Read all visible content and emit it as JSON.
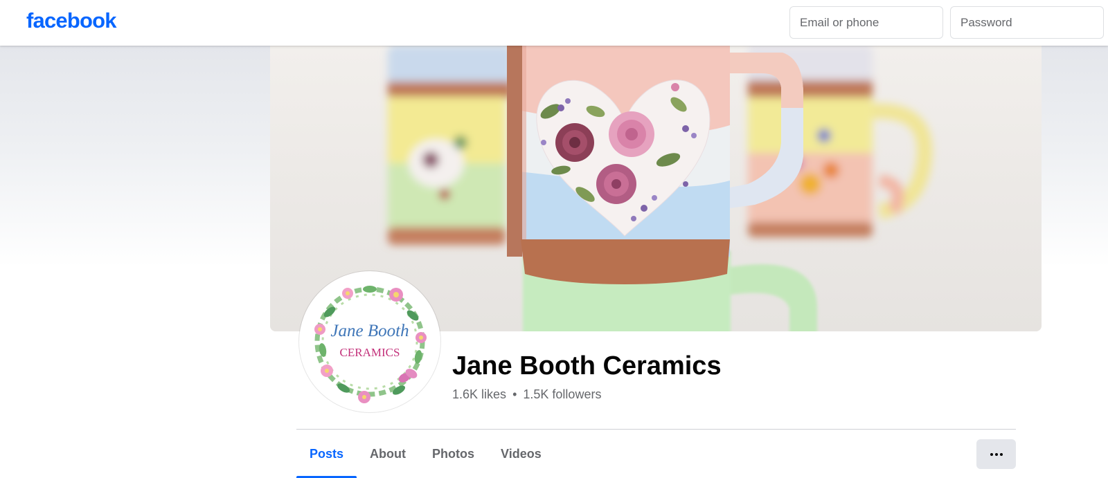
{
  "header": {
    "logo_text": "facebook",
    "email_placeholder": "Email or phone",
    "password_placeholder": "Password",
    "brand_color": "#0866ff"
  },
  "cover": {
    "image": "cover-photo-floral-mugs"
  },
  "avatar": {
    "image": "jane-booth-ceramics-logo-wreath",
    "logo_line1": "Jane Booth",
    "logo_line2": "CERAMICS"
  },
  "profile": {
    "name": "Jane Booth Ceramics",
    "likes": "1.6K likes",
    "separator": "•",
    "followers": "1.5K followers"
  },
  "tabs": [
    {
      "label": "Posts",
      "active": true
    },
    {
      "label": "About",
      "active": false
    },
    {
      "label": "Photos",
      "active": false
    },
    {
      "label": "Videos",
      "active": false
    }
  ],
  "more_button": {
    "icon": "more-dots-icon"
  }
}
